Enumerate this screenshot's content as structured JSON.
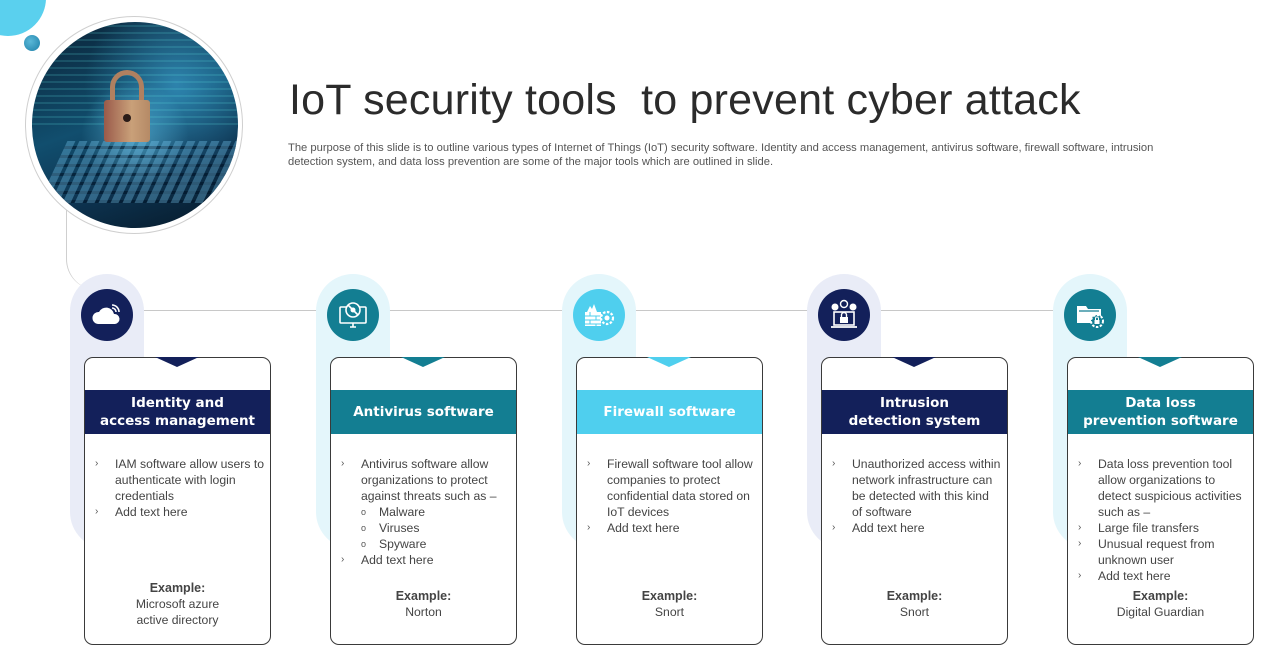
{
  "slide": {
    "title": "IoT security tools  to prevent cyber attack",
    "subtitle": "The purpose of this slide is to outline various types of Internet of Things (IoT) security software. Identity and access management, antivirus software, firewall software, intrusion detection system, and data loss prevention are some of the major tools which are outlined in slide.",
    "hero_image": "padlock-on-laptop-keyboard-image"
  },
  "colors": {
    "navy": "#13205a",
    "teal": "#137e92",
    "cyan": "#4fcfee",
    "navy_pill": "#e9ecf7",
    "teal_pill": "#e4f6fb",
    "cyan_pill": "#e4f6fb"
  },
  "tools": [
    {
      "icon": "cloud-wifi-icon",
      "header": [
        "Identity and",
        "access management"
      ],
      "bullets": [
        {
          "text": "IAM software allow users to authenticate with login credentials"
        },
        {
          "text": "Add text here"
        }
      ],
      "example_label": "Example:",
      "example_value": [
        "Microsoft azure",
        "active directory"
      ]
    },
    {
      "icon": "monitor-virus-blocked-icon",
      "header": [
        "Antivirus software"
      ],
      "bullets": [
        {
          "text": "Antivirus  software allow organizations  to protect against threats such as –",
          "sub": [
            "Malware",
            "Viruses",
            "Spyware"
          ]
        },
        {
          "text": "Add text here"
        }
      ],
      "example_label": "Example:",
      "example_value": [
        "Norton"
      ]
    },
    {
      "icon": "firewall-gear-icon",
      "header": [
        "Firewall software"
      ],
      "bullets": [
        {
          "text": "Firewall software tool allow companies to protect confidential data stored on IoT devices"
        },
        {
          "text": "Add text here"
        }
      ],
      "example_label": "Example:",
      "example_value": [
        "Snort"
      ]
    },
    {
      "icon": "laptop-lock-alerts-icon",
      "header": [
        "Intrusion",
        "detection system"
      ],
      "bullets": [
        {
          "text": "Unauthorized access within network infrastructure can be detected with this kind of software"
        },
        {
          "text": "Add text here"
        }
      ],
      "example_label": "Example:",
      "example_value": [
        "Snort"
      ]
    },
    {
      "icon": "folder-lock-gear-icon",
      "header": [
        "Data loss",
        "prevention software"
      ],
      "bullets": [
        {
          "text": "Data loss prevention  tool allow organizations to detect suspicious activities such as –"
        },
        {
          "text": "Large file transfers"
        },
        {
          "text": "Unusual request from unknown user"
        },
        {
          "text": "Add text here"
        }
      ],
      "example_label": "Example:",
      "example_value": [
        "Digital Guardian"
      ]
    }
  ]
}
